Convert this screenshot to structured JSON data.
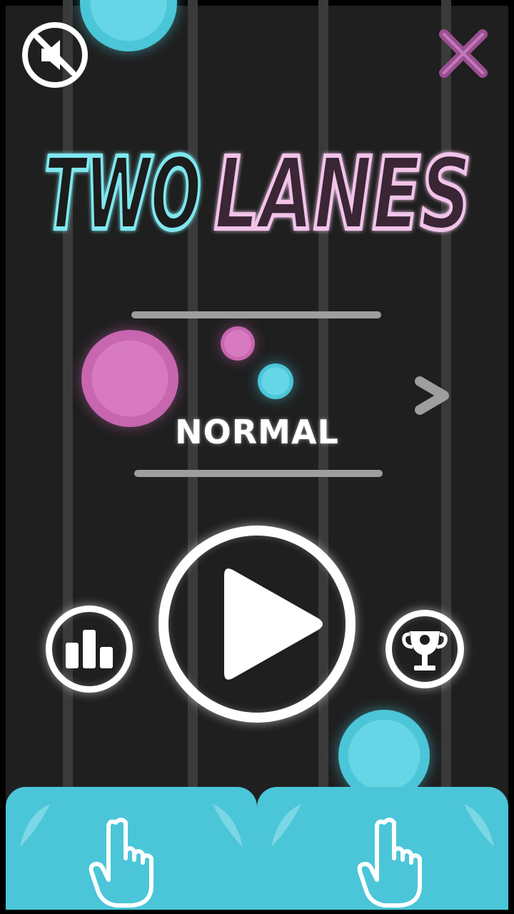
{
  "game": {
    "title_part1": "TWO",
    "title_part2": "LANES",
    "mode": "NORMAL"
  },
  "buttons": {
    "mute": "mute-icon",
    "close": "close-icon",
    "next": "chevron-right-icon",
    "play": "play-icon",
    "leaderboard": "bar-chart-icon",
    "achievements": "trophy-icon"
  },
  "colors": {
    "background": "#1f1f1f",
    "lane": "#3a3a3a",
    "cyan": "#4bc6d8",
    "pink": "#c866b0",
    "close_purple": "#9b4f92"
  }
}
